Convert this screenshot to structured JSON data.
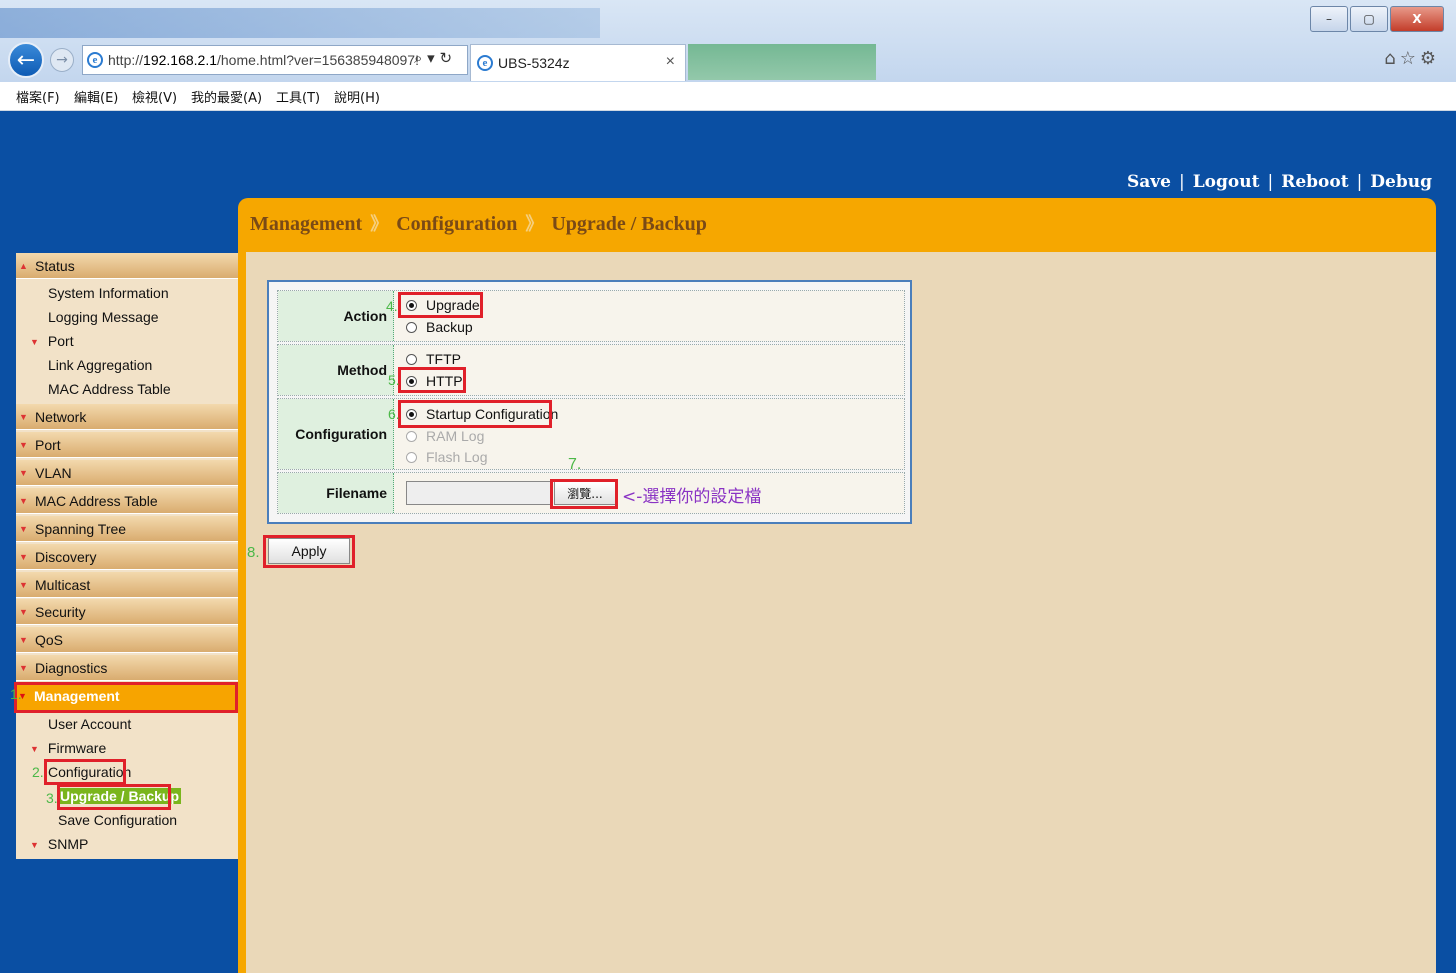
{
  "browser": {
    "url_prefix": "http://",
    "url_host": "192.168.2.1",
    "url_path": "/home.html?ver=156385948097!",
    "tab_title": "UBS-5324z",
    "tab_close": "×",
    "search_glyph": "⌕ ▾ ↻",
    "window_controls": {
      "minimize": "–",
      "maximize": "▢",
      "close": "X"
    },
    "right_icons": "⌂☆⚙"
  },
  "menubar": [
    "檔案(F)",
    "編輯(E)",
    "檢視(V)",
    "我的最愛(A)",
    "工具(T)",
    "說明(H)"
  ],
  "toplinks": [
    "Save",
    "Logout",
    "Reboot",
    "Debug"
  ],
  "toplinks_sep": "|",
  "breadcrumb": [
    "Management",
    "Configuration",
    "Upgrade / Backup"
  ],
  "breadcrumb_sep": "》",
  "sidebar": {
    "status": "Status",
    "status_items": [
      "System Information",
      "Logging Message",
      "Port",
      "Link Aggregation",
      "MAC Address Table"
    ],
    "sections": [
      "Network",
      "Port",
      "VLAN",
      "MAC Address Table",
      "Spanning Tree",
      "Discovery",
      "Multicast",
      "Security",
      "QoS",
      "Diagnostics",
      "Management"
    ],
    "management_items": {
      "user_account": "User Account",
      "firmware": "Firmware",
      "configuration": "Configuration",
      "upgrade_backup": "Upgrade / Backup",
      "save_configuration": "Save Configuration",
      "snmp": "SNMP"
    }
  },
  "annotations": {
    "n1": "1.",
    "n2": "2.",
    "n3": "3.",
    "n4": "4.",
    "n5": "5.",
    "n6": "6.",
    "n7": "7.",
    "n8": "8."
  },
  "form": {
    "action_label": "Action",
    "action_options": [
      "Upgrade",
      "Backup"
    ],
    "action_selected": "Upgrade",
    "method_label": "Method",
    "method_options": [
      "TFTP",
      "HTTP"
    ],
    "method_selected": "HTTP",
    "config_label": "Configuration",
    "config_options": [
      "Startup Configuration",
      "RAM Log",
      "Flash Log"
    ],
    "config_selected": "Startup Configuration",
    "filename_label": "Filename",
    "filename_value": "",
    "browse_label": "瀏覽...",
    "hint": "<-選擇你的設定檔",
    "apply_label": "Apply"
  }
}
